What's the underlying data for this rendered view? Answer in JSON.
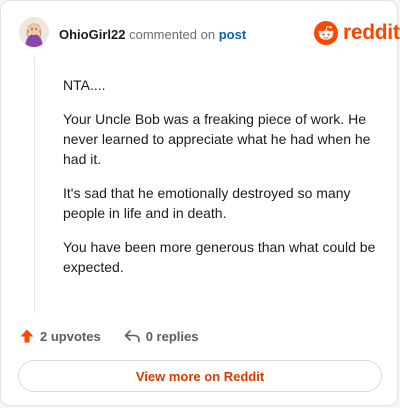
{
  "header": {
    "username": "OhioGirl22",
    "action_text": "commented on",
    "post_link": "post"
  },
  "brand": {
    "wordmark": "reddit",
    "logo_icon": "reddit-alien-icon",
    "color": "#ff4500"
  },
  "comment": {
    "paragraphs": [
      "NTA....",
      "Your Uncle Bob was a freaking piece of work. He never learned to appreciate what he had when he had it.",
      "It's sad that he emotionally destroyed so many people in life and in death.",
      "You have been more generous than what could be expected."
    ]
  },
  "footer": {
    "upvote_icon": "upvote-arrow-icon",
    "upvotes": "2 upvotes",
    "reply_icon": "reply-arrow-icon",
    "replies": "0 replies"
  },
  "cta": {
    "label": "View more on Reddit",
    "color": "#d93a00"
  }
}
